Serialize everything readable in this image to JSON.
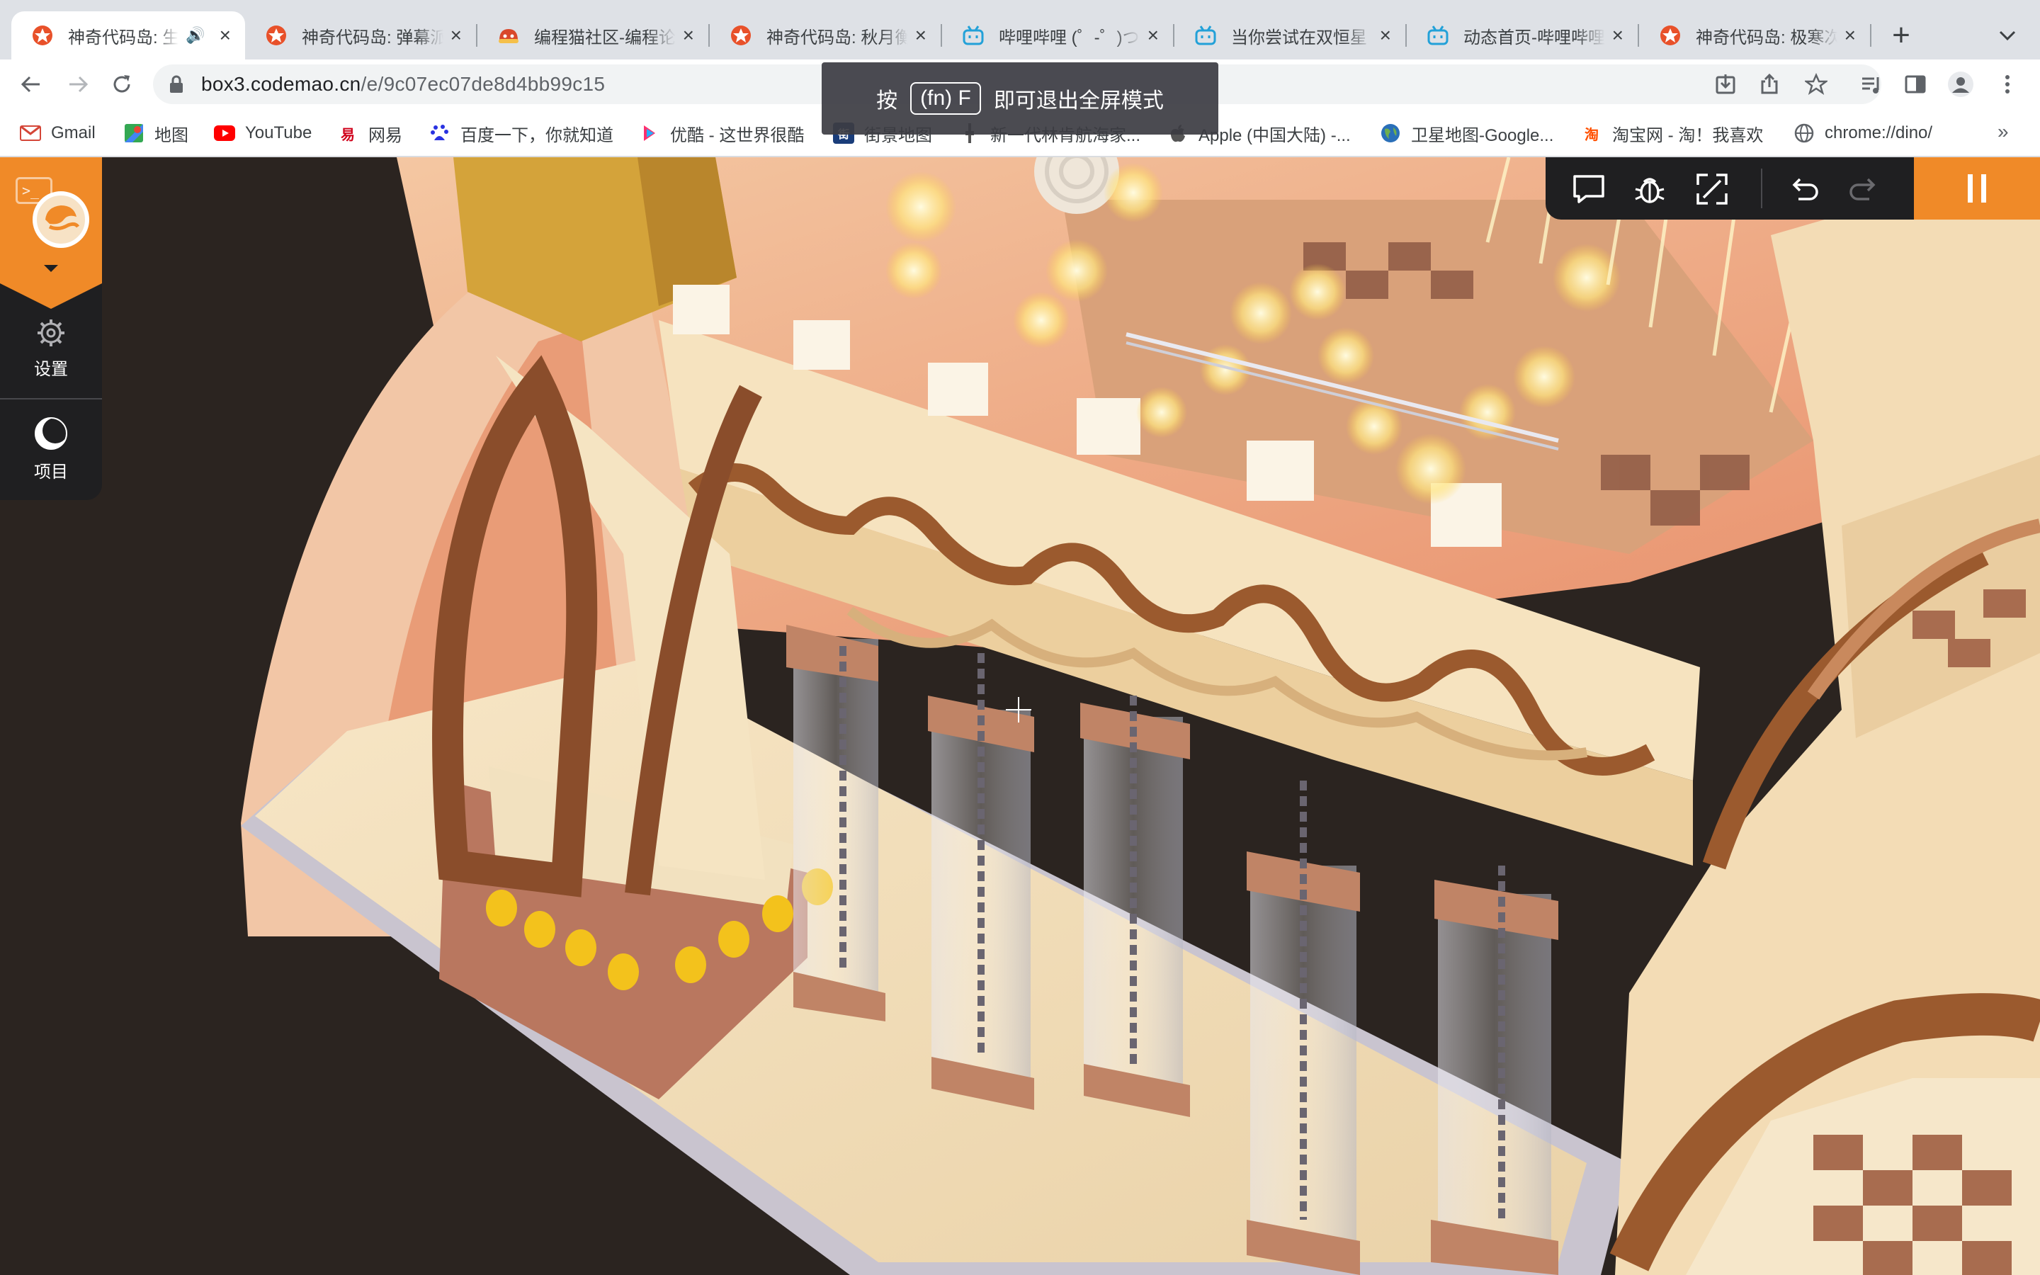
{
  "browser": {
    "tabs": [
      {
        "title": "神奇代码岛: 生",
        "favicon": "codemao-star-icon",
        "active": true,
        "audio": true
      },
      {
        "title": "神奇代码岛: 弹幕派",
        "favicon": "codemao-star-icon"
      },
      {
        "title": "编程猫社区-编程论",
        "favicon": "codemao-cat-icon"
      },
      {
        "title": "神奇代码岛: 秋月衡",
        "favicon": "codemao-star-icon"
      },
      {
        "title": "哔哩哔哩 (゜-゜)つ",
        "favicon": "bilibili-tv-icon"
      },
      {
        "title": "当你尝试在双恒星",
        "favicon": "bilibili-tv-icon"
      },
      {
        "title": "动态首页-哔哩哔哩",
        "favicon": "bilibili-tv-icon"
      },
      {
        "title": "神奇代码岛: 极寒次",
        "favicon": "codemao-star-icon"
      }
    ],
    "url_host": "box3.codemao.cn",
    "url_path": "/e/9c07ec07de8d4bb99c15",
    "bookmarks": [
      {
        "label": "Gmail",
        "icon": "gmail-icon"
      },
      {
        "label": "地图",
        "icon": "maps-icon"
      },
      {
        "label": "YouTube",
        "icon": "youtube-icon"
      },
      {
        "label": "网易",
        "icon": "netease-icon"
      },
      {
        "label": "百度一下，你就知道",
        "icon": "baidu-icon"
      },
      {
        "label": "优酷 - 这世界很酷",
        "icon": "youku-icon"
      },
      {
        "label": "街景地图",
        "icon": "streetview-icon"
      },
      {
        "label": "新一代林肯航海家...",
        "icon": "lincoln-icon"
      },
      {
        "label": "Apple (中国大陆) -...",
        "icon": "apple-icon"
      },
      {
        "label": "卫星地图-Google...",
        "icon": "globe-icon"
      },
      {
        "label": "淘宝网 - 淘！我喜欢",
        "icon": "taobao-icon"
      },
      {
        "label": "chrome://dino/",
        "icon": "chrome-globe-icon"
      }
    ],
    "bookmarks_more": "»"
  },
  "fullscreen_toast": {
    "prefix": "按",
    "key": "(fn) F",
    "suffix": "即可退出全屏模式"
  },
  "editor": {
    "settings_label": "设置",
    "project_label": "项目",
    "console_glyph": ">_"
  },
  "colors": {
    "accent_orange": "#f08a28",
    "panel_dark": "#1f1f21",
    "tab_strip": "#dee1e6"
  }
}
